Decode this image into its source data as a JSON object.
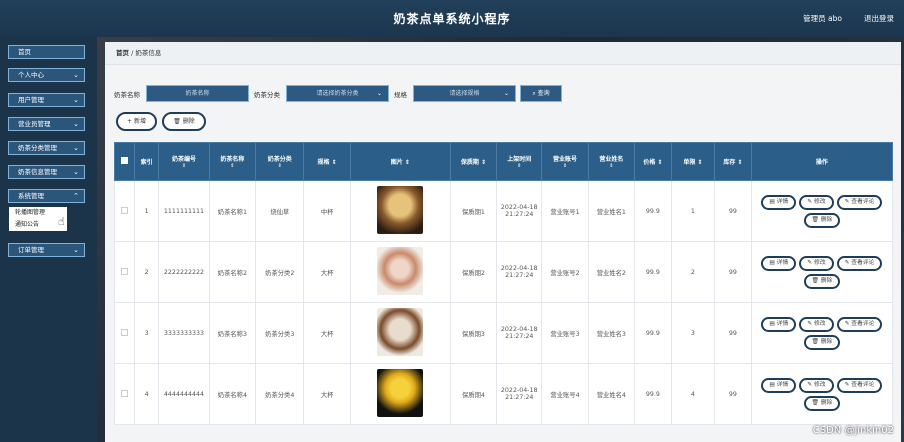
{
  "header": {
    "title": "奶茶点单系统小程序",
    "user": "管理员 abo",
    "logout": "退出登录"
  },
  "sidebar": {
    "items": [
      {
        "label": "首页",
        "has_chevron": false
      },
      {
        "label": "个人中心",
        "has_chevron": true
      },
      {
        "label": "用户管理",
        "has_chevron": true
      },
      {
        "label": "营业员管理",
        "has_chevron": true
      },
      {
        "label": "奶茶分类管理",
        "has_chevron": true
      },
      {
        "label": "奶茶信息管理",
        "has_chevron": true
      },
      {
        "label": "系统管理",
        "has_chevron": true
      },
      {
        "label": "订单管理",
        "has_chevron": true
      }
    ],
    "submenu": [
      "轮播图管理",
      "通知公告"
    ]
  },
  "breadcrumb": {
    "home": "首页",
    "sep": "/",
    "current": "奶茶信息"
  },
  "search": {
    "name_label": "奶茶名称",
    "name_placeholder": "奶茶名称",
    "category_label": "奶茶分类",
    "category_placeholder": "请选择奶茶分类",
    "spec_label": "规格",
    "spec_placeholder": "请选择规格",
    "query": "查询"
  },
  "actions": {
    "add": "新增",
    "delete": "删除"
  },
  "table": {
    "headers": [
      "索引",
      "奶茶编号",
      "奶茶名称",
      "奶茶分类",
      "规格",
      "图片",
      "保质期",
      "上架时间",
      "营业账号",
      "营业姓名",
      "价格",
      "单限",
      "库存",
      "操作"
    ],
    "rows": [
      {
        "index": "1",
        "code": "1111111111",
        "name": "奶茶名称1",
        "category": "烧仙草",
        "spec": "中杯",
        "shelf": "保质期1",
        "time": "2022-04-18 21:27:24",
        "account": "营业账号1",
        "staff": "营业姓名1",
        "price": "99.9",
        "limit": "1",
        "stock": "99"
      },
      {
        "index": "2",
        "code": "2222222222",
        "name": "奶茶名称2",
        "category": "奶茶分类2",
        "spec": "大杯",
        "shelf": "保质期2",
        "time": "2022-04-18 21:27:24",
        "account": "营业账号2",
        "staff": "营业姓名2",
        "price": "99.9",
        "limit": "2",
        "stock": "99"
      },
      {
        "index": "3",
        "code": "3333333333",
        "name": "奶茶名称3",
        "category": "奶茶分类3",
        "spec": "大杯",
        "shelf": "保质期3",
        "time": "2022-04-18 21:27:24",
        "account": "营业账号3",
        "staff": "营业姓名3",
        "price": "99.9",
        "limit": "3",
        "stock": "99"
      },
      {
        "index": "4",
        "code": "4444444444",
        "name": "奶茶名称4",
        "category": "奶茶分类4",
        "spec": "大杯",
        "shelf": "保质期4",
        "time": "2022-04-18 21:27:24",
        "account": "营业账号4",
        "staff": "营业姓名4",
        "price": "99.9",
        "limit": "4",
        "stock": "99"
      }
    ],
    "op_labels": {
      "detail": "详情",
      "edit": "修改",
      "review": "查看评论",
      "delete": "删除"
    }
  },
  "watermark": "CSDN @jinkin02"
}
